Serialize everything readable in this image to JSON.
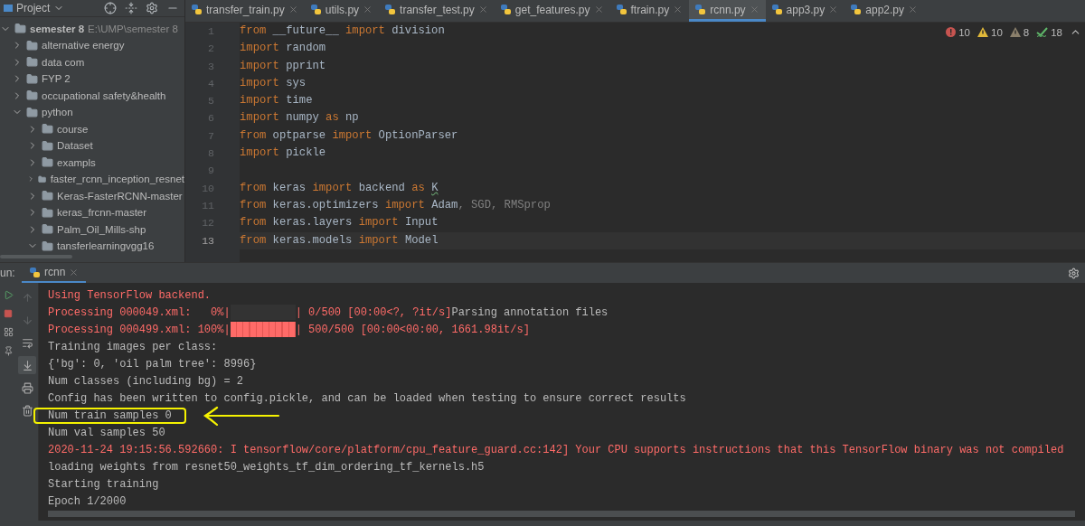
{
  "project_panel": {
    "title": "Project",
    "tree": [
      {
        "name": "semester 8",
        "path": "E:\\UMP\\semester 8",
        "expanded": true,
        "children": [
          {
            "name": "alternative energy",
            "expanded": false
          },
          {
            "name": "data com",
            "expanded": false
          },
          {
            "name": "FYP 2",
            "expanded": false
          },
          {
            "name": "occupational safety&health",
            "expanded": false
          },
          {
            "name": "python",
            "expanded": true,
            "children": [
              {
                "name": "course",
                "expanded": false
              },
              {
                "name": "Dataset",
                "expanded": false
              },
              {
                "name": "exampls",
                "expanded": false
              },
              {
                "name": "faster_rcnn_inception_resnet",
                "expanded": false
              },
              {
                "name": "Keras-FasterRCNN-master",
                "expanded": false
              },
              {
                "name": "keras_frcnn-master",
                "expanded": false
              },
              {
                "name": "Palm_Oil_Mills-shp",
                "expanded": false
              },
              {
                "name": "tansferlearningvgg16",
                "expanded": true
              }
            ]
          }
        ]
      }
    ]
  },
  "editor": {
    "tabs": [
      {
        "label": "transfer_train.py",
        "selected": false
      },
      {
        "label": "utils.py",
        "selected": false
      },
      {
        "label": "transfer_test.py",
        "selected": false
      },
      {
        "label": "get_features.py",
        "selected": false
      },
      {
        "label": "ftrain.py",
        "selected": false
      },
      {
        "label": "rcnn.py",
        "selected": true
      },
      {
        "label": "app3.py",
        "selected": false
      },
      {
        "label": "app2.py",
        "selected": false
      }
    ],
    "inspections": [
      {
        "kind": "error",
        "count": "10"
      },
      {
        "kind": "warning",
        "count": "10"
      },
      {
        "kind": "weak",
        "count": "8"
      },
      {
        "kind": "typo",
        "count": "18"
      }
    ],
    "lines": [
      {
        "number": "1",
        "current": false,
        "tokens": [
          {
            "kind": "keyword",
            "text": "from"
          },
          {
            "kind": "plain",
            "text": " __future__ "
          },
          {
            "kind": "keyword",
            "text": "import"
          },
          {
            "kind": "plain",
            "text": " division"
          }
        ]
      },
      {
        "number": "2",
        "current": false,
        "tokens": [
          {
            "kind": "keyword",
            "text": "import"
          },
          {
            "kind": "plain",
            "text": " random"
          }
        ]
      },
      {
        "number": "3",
        "current": false,
        "tokens": [
          {
            "kind": "keyword",
            "text": "import"
          },
          {
            "kind": "plain",
            "text": " pprint"
          }
        ]
      },
      {
        "number": "4",
        "current": false,
        "tokens": [
          {
            "kind": "keyword",
            "text": "import"
          },
          {
            "kind": "plain",
            "text": " sys"
          }
        ]
      },
      {
        "number": "5",
        "current": false,
        "tokens": [
          {
            "kind": "keyword",
            "text": "import"
          },
          {
            "kind": "plain",
            "text": " time"
          }
        ]
      },
      {
        "number": "6",
        "current": false,
        "tokens": [
          {
            "kind": "keyword",
            "text": "import"
          },
          {
            "kind": "plain",
            "text": " numpy "
          },
          {
            "kind": "keyword",
            "text": "as"
          },
          {
            "kind": "plain",
            "text": " np"
          }
        ]
      },
      {
        "number": "7",
        "current": false,
        "tokens": [
          {
            "kind": "keyword",
            "text": "from"
          },
          {
            "kind": "plain",
            "text": " optparse "
          },
          {
            "kind": "keyword",
            "text": "import"
          },
          {
            "kind": "plain",
            "text": " OptionParser"
          }
        ]
      },
      {
        "number": "8",
        "current": false,
        "tokens": [
          {
            "kind": "keyword",
            "text": "import"
          },
          {
            "kind": "plain",
            "text": " pickle"
          }
        ]
      },
      {
        "number": "9",
        "current": false
      },
      {
        "number": "10",
        "current": false,
        "tokens": [
          {
            "kind": "keyword",
            "text": "from"
          },
          {
            "kind": "plain",
            "text": " keras "
          },
          {
            "kind": "keyword",
            "text": "import"
          },
          {
            "kind": "plain",
            "text": " backend "
          },
          {
            "kind": "keyword",
            "text": "as "
          },
          {
            "kind": "typo",
            "text": "K"
          }
        ]
      },
      {
        "number": "11",
        "current": false,
        "tokens": [
          {
            "kind": "keyword",
            "text": "from"
          },
          {
            "kind": "plain",
            "text": " keras.optimizers "
          },
          {
            "kind": "keyword",
            "text": "import"
          },
          {
            "kind": "plain",
            "text": " Adam"
          },
          {
            "kind": "unused",
            "text": ", SGD, RMSprop"
          }
        ]
      },
      {
        "number": "12",
        "current": false,
        "tokens": [
          {
            "kind": "keyword",
            "text": "from"
          },
          {
            "kind": "plain",
            "text": " keras.layers "
          },
          {
            "kind": "keyword",
            "text": "import"
          },
          {
            "kind": "plain",
            "text": " Input"
          }
        ]
      },
      {
        "number": "13",
        "current": true,
        "tokens": [
          {
            "kind": "keyword",
            "text": "from"
          },
          {
            "kind": "plain",
            "text": " keras.models "
          },
          {
            "kind": "keyword",
            "text": "import"
          },
          {
            "kind": "plain",
            "text": " Model"
          }
        ]
      }
    ]
  },
  "run_panel": {
    "label": "un:",
    "tab": "rcnn",
    "console": [
      {
        "highlighted": false,
        "segments": [
          {
            "kind": "stderr",
            "text": "Using TensorFlow backend."
          }
        ]
      },
      {
        "highlighted": false,
        "segments": [
          {
            "kind": "stderr",
            "text": "Processing 000049.xml:   0%|"
          },
          {
            "kind": "bar",
            "level": 0
          },
          {
            "kind": "stderr",
            "text": "| 0/500 [00:00<?, ?it/s]"
          },
          {
            "kind": "stdout",
            "text": "Parsing annotation files"
          }
        ]
      },
      {
        "highlighted": false,
        "segments": [
          {
            "kind": "stderr",
            "text": "Processing 000499.xml: 100%|"
          },
          {
            "kind": "bar",
            "level": 1
          },
          {
            "kind": "stderr",
            "text": "| 500/500 [00:00<00:00, 1661.98it/s]"
          }
        ]
      },
      {
        "highlighted": false,
        "segments": [
          {
            "kind": "stdout",
            "text": "Training images per class:"
          }
        ]
      },
      {
        "highlighted": false,
        "segments": [
          {
            "kind": "stdout",
            "text": "{'bg': 0, 'oil palm tree': 8996}"
          }
        ]
      },
      {
        "highlighted": false,
        "segments": [
          {
            "kind": "stdout",
            "text": "Num classes (including bg) = 2"
          }
        ]
      },
      {
        "highlighted": false,
        "segments": [
          {
            "kind": "stdout",
            "text": "Config has been written to config.pickle, and can be loaded when testing to ensure correct results"
          }
        ]
      },
      {
        "highlighted": true,
        "segments": [
          {
            "kind": "stdout",
            "text": "Num train samples 0"
          }
        ]
      },
      {
        "highlighted": false,
        "segments": [
          {
            "kind": "stdout",
            "text": "Num val samples 50"
          }
        ]
      },
      {
        "highlighted": false,
        "segments": [
          {
            "kind": "stderr",
            "text": "2020-11-24 19:15:56.592660: I tensorflow/core/platform/cpu_feature_guard.cc:142] Your CPU supports instructions that this TensorFlow binary was not compiled"
          }
        ]
      },
      {
        "highlighted": false,
        "segments": [
          {
            "kind": "stdout",
            "text": "loading weights from resnet50_weights_tf_dim_ordering_tf_kernels.h5"
          }
        ]
      },
      {
        "highlighted": false,
        "segments": [
          {
            "kind": "stdout",
            "text": "Starting training"
          }
        ]
      },
      {
        "highlighted": false,
        "segments": [
          {
            "kind": "stdout",
            "text": "Epoch 1/2000"
          }
        ]
      }
    ]
  }
}
